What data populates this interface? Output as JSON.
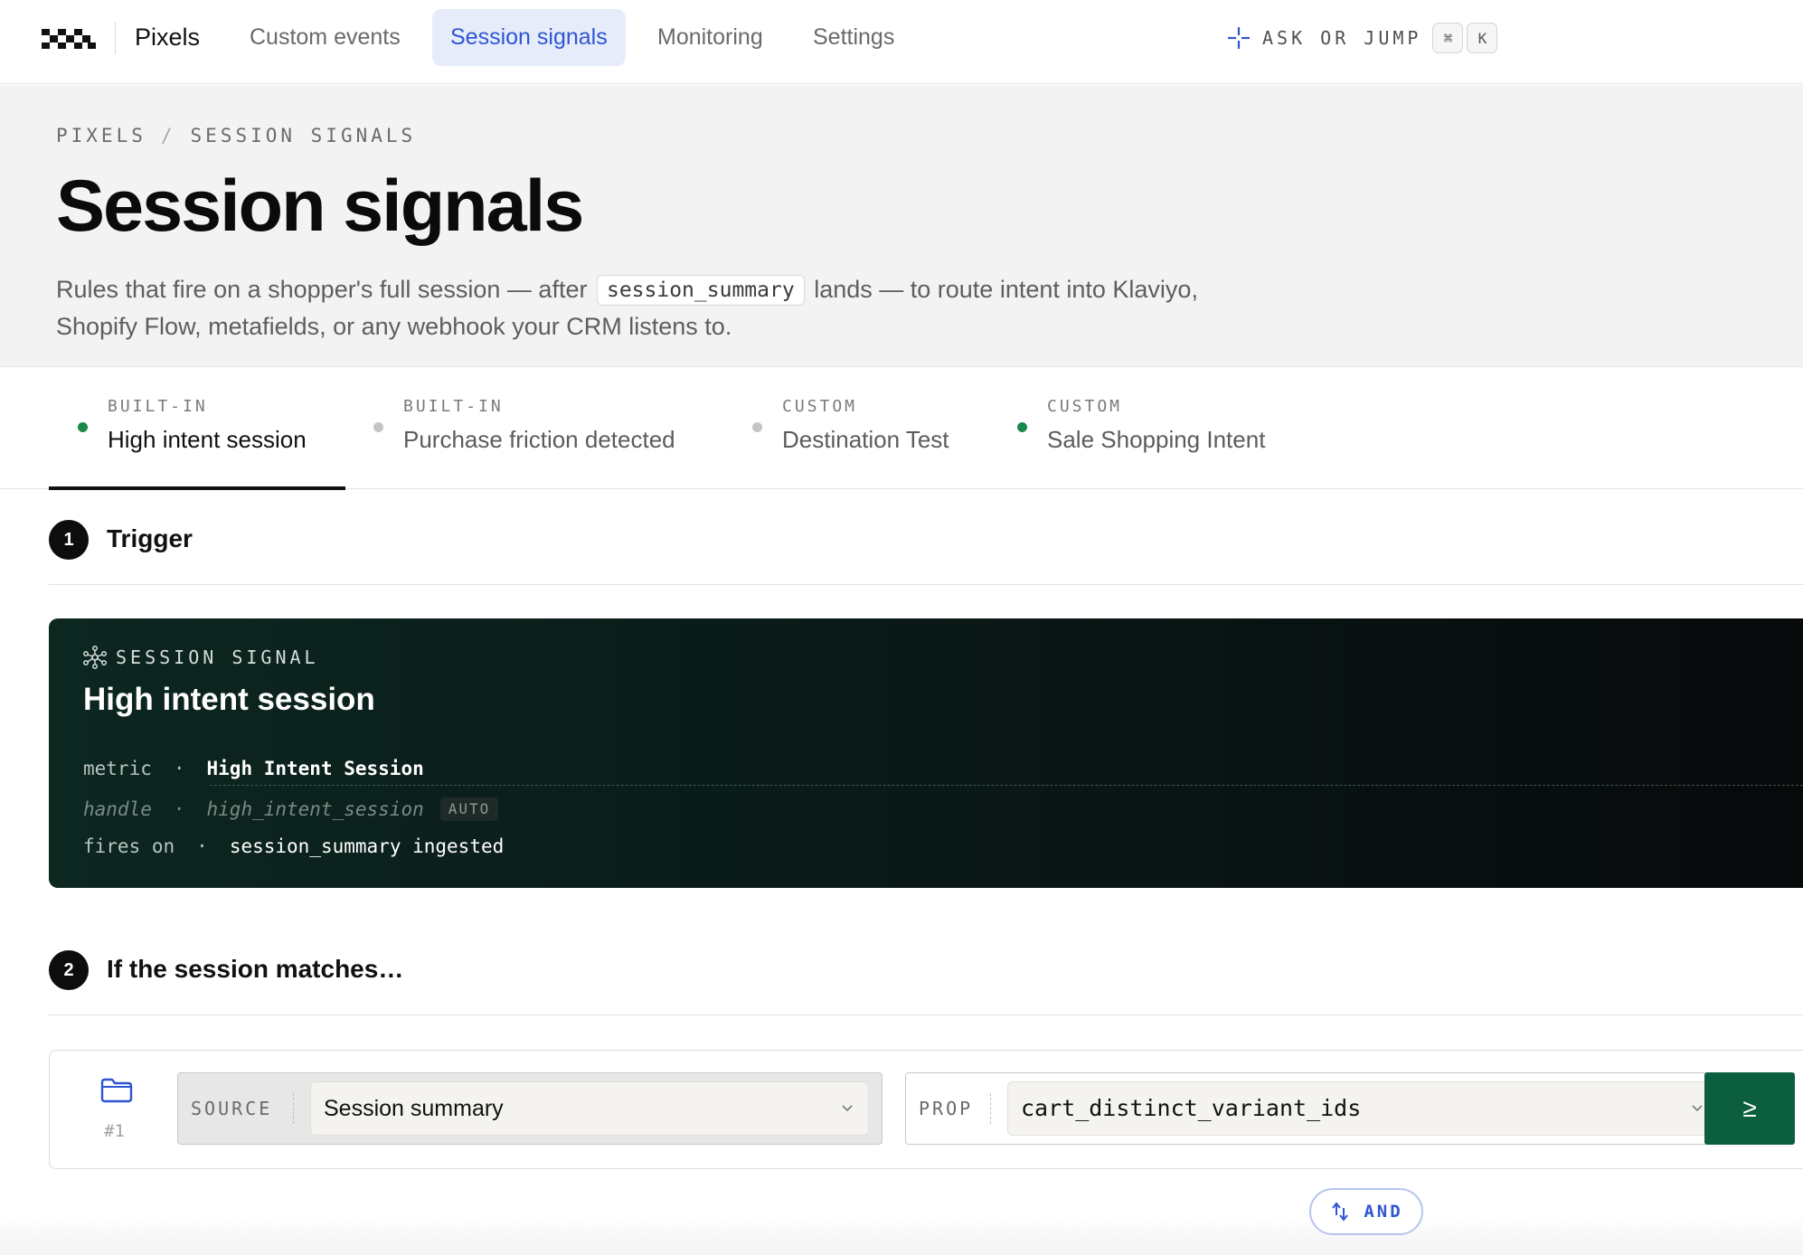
{
  "app": {
    "brand": "Pixels"
  },
  "nav": {
    "tabs": [
      {
        "label": "Custom events",
        "active": false
      },
      {
        "label": "Session signals",
        "active": true
      },
      {
        "label": "Monitoring",
        "active": false
      },
      {
        "label": "Settings",
        "active": false
      }
    ],
    "ask_label": "ASK OR JUMP",
    "shortcut_keys": [
      "⌘",
      "K"
    ]
  },
  "header": {
    "breadcrumb": [
      "PIXELS",
      "SESSION SIGNALS"
    ],
    "breadcrumb_sep": "/",
    "title": "Session signals",
    "description_before": "Rules that fire on a shopper's full session — after",
    "description_code": "session_summary",
    "description_after": "lands — to route intent into Klaviyo, Shopify Flow, metafields, or any webhook your CRM listens to."
  },
  "signals": [
    {
      "kicker": "BUILT-IN",
      "name": "High intent session",
      "status_color": "#1a8a4a",
      "active": true
    },
    {
      "kicker": "BUILT-IN",
      "name": "Purchase friction detected",
      "status_color": "#c4c4c4",
      "active": false
    },
    {
      "kicker": "CUSTOM",
      "name": "Destination Test",
      "status_color": "#c4c4c4",
      "active": false
    },
    {
      "kicker": "CUSTOM",
      "name": "Sale Shopping Intent",
      "status_color": "#1a8a4a",
      "active": false
    }
  ],
  "steps": {
    "trigger": {
      "number": "1",
      "title": "Trigger"
    },
    "match": {
      "number": "2",
      "title": "If the session matches…"
    }
  },
  "signal_card": {
    "kicker": "SESSION SIGNAL",
    "icon": "network-nodes-icon",
    "title": "High intent session",
    "rows": {
      "metric": {
        "key": "metric",
        "sep": "·",
        "value": "High Intent Session"
      },
      "handle": {
        "key": "handle",
        "sep": "·",
        "value": "high_intent_session",
        "tag": "AUTO"
      },
      "fires_on": {
        "key": "fires on",
        "sep": "·",
        "value": "session_summary ingested"
      }
    }
  },
  "condition": {
    "icon": "folder-icon",
    "index": "#1",
    "source_label": "SOURCE",
    "source_value": "Session summary",
    "prop_label": "PROP",
    "prop_value": "cart_distinct_variant_ids",
    "operator": "≥"
  },
  "and_button": {
    "label": "AND",
    "icon": "swap-arrows-icon"
  },
  "colors": {
    "accent": "#2f55d4",
    "accent_bg": "#e6ecfa",
    "operator_green": "#0b5e3e",
    "status_green": "#1a8a4a"
  }
}
